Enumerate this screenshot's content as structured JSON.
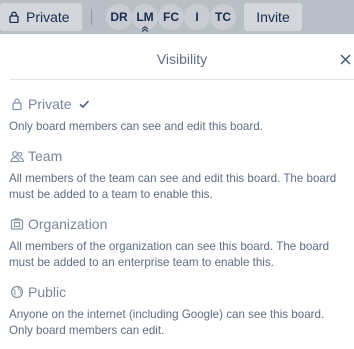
{
  "header_bar": {
    "privacy_label": "Private",
    "members": [
      {
        "initials": "DR"
      },
      {
        "initials": "LM"
      },
      {
        "initials": "FC"
      },
      {
        "initials": "I"
      },
      {
        "initials": "TC"
      }
    ],
    "invite_label": "Invite"
  },
  "popover": {
    "title": "Visibility",
    "options": [
      {
        "label": "Private",
        "selected": true,
        "icon": "lock-icon",
        "description": "Only board members can see and edit this board."
      },
      {
        "label": "Team",
        "selected": false,
        "icon": "team-icon",
        "description": "All members of the team can see and edit this board. The board must be added to a team to enable this."
      },
      {
        "label": "Organization",
        "selected": false,
        "icon": "organization-icon",
        "description": "All members of the organization can see this board. The board must be added to an enterprise team to enable this."
      },
      {
        "label": "Public",
        "selected": false,
        "icon": "globe-icon",
        "description": "Anyone on the internet (including Google) can see this board. Only board members can edit."
      }
    ]
  },
  "colors": {
    "topbar": "#b9bfc6",
    "button": "#d3d7dc",
    "text_dark": "#172b4d",
    "text_muted": "#5e6c84",
    "label_muted": "#7a869a"
  }
}
